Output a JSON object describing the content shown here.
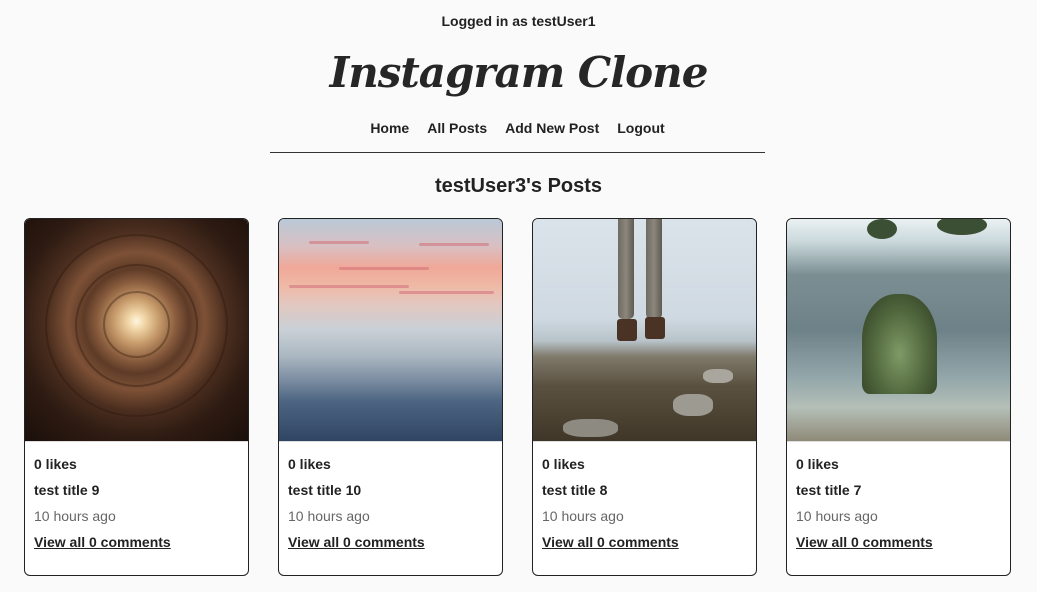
{
  "header": {
    "login_status": "Logged in as testUser1",
    "logo": "Instagram Clone"
  },
  "nav": {
    "items": [
      {
        "label": "Home"
      },
      {
        "label": "All Posts"
      },
      {
        "label": "Add New Post"
      },
      {
        "label": "Logout"
      }
    ]
  },
  "main": {
    "title": "testUser3's Posts"
  },
  "posts": [
    {
      "likes": "0 likes",
      "title": "test title 9",
      "time": "10 hours ago",
      "comments": "View all 0 comments",
      "image": "tunnel-photo"
    },
    {
      "likes": "0 likes",
      "title": "test title 10",
      "time": "10 hours ago",
      "comments": "View all 0 comments",
      "image": "ocean-sunset-photo"
    },
    {
      "likes": "0 likes",
      "title": "test title 8",
      "time": "10 hours ago",
      "comments": "View all 0 comments",
      "image": "hiker-feet-photo"
    },
    {
      "likes": "0 likes",
      "title": "test title 7",
      "time": "10 hours ago",
      "comments": "View all 0 comments",
      "image": "rock-arch-photo"
    }
  ]
}
